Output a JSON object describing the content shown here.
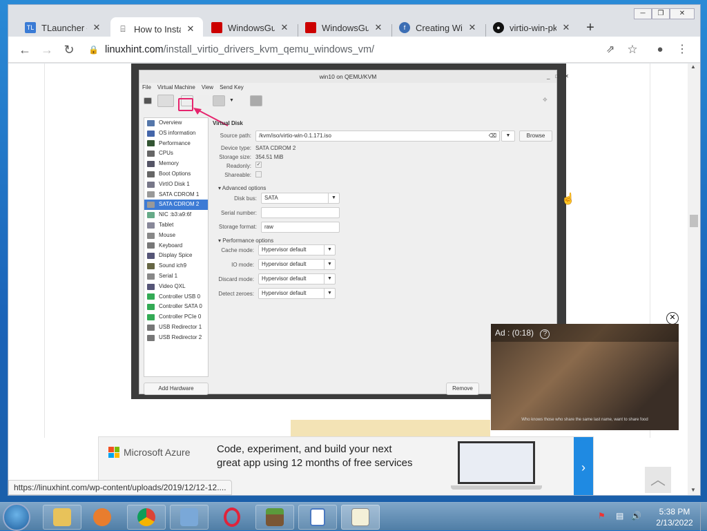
{
  "window": {
    "controls": [
      "─",
      "❐",
      "✕"
    ]
  },
  "tabs": [
    {
      "title": "TLauncher – I",
      "icon": "TL",
      "color": "#3a7bd5",
      "active": false
    },
    {
      "title": "How to Instal",
      "icon": "lh",
      "color": "#333333",
      "active": true
    },
    {
      "title": "WindowsGue",
      "icon": "rh",
      "color": "#cc0000",
      "active": false
    },
    {
      "title": "WindowsGue",
      "icon": "rh",
      "color": "#cc0000",
      "active": false
    },
    {
      "title": "Creating Win",
      "icon": "fd",
      "color": "#3c6eb4",
      "active": false
    },
    {
      "title": "virtio-win-pk",
      "icon": "gh",
      "color": "#111111",
      "active": false
    }
  ],
  "toolbar": {
    "url_domain": "linuxhint.com",
    "url_path": "/install_virtio_drivers_kvm_qemu_windows_vm/"
  },
  "vm": {
    "title": "win10 on QEMU/KVM",
    "menu": [
      "File",
      "Virtual Machine",
      "View",
      "Send Key"
    ],
    "hardware": [
      "Overview",
      "OS information",
      "Performance",
      "CPUs",
      "Memory",
      "Boot Options",
      "VirtIO Disk 1",
      "SATA CDROM 1",
      "SATA CDROM 2",
      "NIC :b3:a9:6f",
      "Tablet",
      "Mouse",
      "Keyboard",
      "Display Spice",
      "Sound ich9",
      "Serial 1",
      "Video QXL",
      "Controller USB 0",
      "Controller SATA 0",
      "Controller PCIe 0",
      "USB Redirector 1",
      "USB Redirector 2"
    ],
    "selected_index": 8,
    "add_hardware": "Add Hardware",
    "remove": "Remove",
    "section_title": "Virtual Disk",
    "source_path_label": "Source path:",
    "source_path": "/kvm/iso/virtio-win-0.1.171.iso",
    "browse": "Browse",
    "device_type_label": "Device type:",
    "device_type": "SATA CDROM 2",
    "storage_size_label": "Storage size:",
    "storage_size": "354.51 MiB",
    "readonly_label": "Readonly:",
    "shareable_label": "Shareable:",
    "advanced": "Advanced options",
    "disk_bus_label": "Disk bus:",
    "disk_bus": "SATA",
    "serial_label": "Serial number:",
    "storage_format_label": "Storage format:",
    "storage_format": "raw",
    "performance": "Performance options",
    "cache_label": "Cache mode:",
    "cache": "Hypervisor default",
    "io_label": "IO mode:",
    "io": "Hypervisor default",
    "discard_label": "Discard mode:",
    "discard": "Hypervisor default",
    "detect_label": "Detect zeroes:",
    "detect": "Hypervisor default"
  },
  "ad_video": {
    "header": "Ad : (0:18)",
    "help": "?",
    "caption": "Who knows those who share the same last name, want to share food"
  },
  "banner": {
    "brand": "Microsoft Azure",
    "line1": "Code, experiment, and build your next",
    "line2": "great app using 12 months of free services",
    "arrow": "›",
    "adchoices": "▷✕"
  },
  "status_url": "https://linuxhint.com/wp-content/uploads/2019/12/12-12....",
  "taskbar": {
    "apps": [
      "explorer",
      "media-player",
      "chrome",
      "control-panel",
      "opera",
      "minecraft",
      "wordpad",
      "paint"
    ],
    "time": "5:38 PM",
    "date": "2/13/2022"
  }
}
